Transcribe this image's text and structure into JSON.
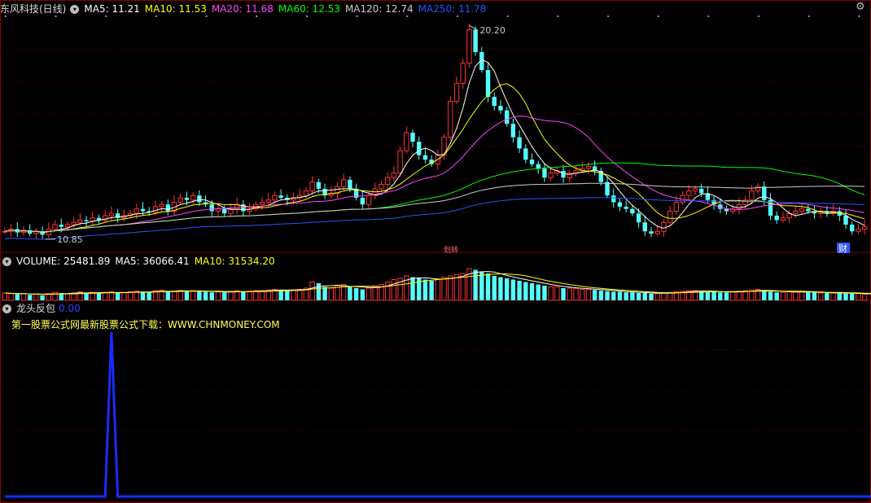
{
  "price_panel": {
    "title": "东风科技(日线)",
    "ma_labels": [
      {
        "text": "MA5: 11.21",
        "color": "#ffffff"
      },
      {
        "text": "MA10: 11.53",
        "color": "#ffff00"
      },
      {
        "text": "MA20: 11.68",
        "color": "#ff44ff"
      },
      {
        "text": "MA60: 12.53",
        "color": "#00ff00"
      },
      {
        "text": "MA120: 12.74",
        "color": "#cccccc"
      },
      {
        "text": "MA250: 11.78",
        "color": "#2255ff"
      }
    ],
    "high_label": "20.20",
    "low_label": "10.85",
    "marker_fin": "财",
    "marker_pink": "划转"
  },
  "volume_panel": {
    "labels": [
      {
        "text": "VOLUME: 25481.89",
        "color": "#ffffff"
      },
      {
        "text": "MA5: 36066.41",
        "color": "#ffffff"
      },
      {
        "text": "MA10: 31534.20",
        "color": "#ffff00"
      }
    ]
  },
  "indicator_panel": {
    "title": "龙头反包",
    "value": "0.00",
    "promo_text": "第一股票公式网最新股票公式下载：WWW.CHNMONEY.COM"
  },
  "colors": {
    "up": "#ff3333",
    "down": "#54ffff",
    "grid": "#7a0000",
    "indicator_line": "#1a2cff"
  },
  "chart_data": {
    "type": "candlestick",
    "close_series": [
      11.0,
      11.1,
      10.95,
      11.05,
      10.9,
      11.0,
      10.85,
      11.1,
      11.3,
      11.2,
      11.3,
      11.4,
      11.5,
      11.45,
      11.6,
      11.5,
      11.7,
      11.8,
      11.6,
      11.7,
      11.8,
      12.0,
      11.9,
      11.85,
      12.1,
      12.2,
      11.9,
      12.3,
      12.5,
      12.4,
      12.6,
      12.3,
      12.2,
      11.9,
      12.0,
      11.8,
      12.0,
      12.2,
      11.9,
      12.0,
      12.2,
      12.3,
      12.4,
      12.6,
      12.5,
      12.4,
      12.5,
      12.6,
      12.8,
      13.2,
      12.9,
      12.6,
      12.7,
      13.0,
      13.3,
      12.9,
      12.5,
      12.2,
      12.6,
      12.9,
      13.1,
      13.4,
      13.6,
      14.6,
      15.4,
      15.0,
      14.4,
      14.2,
      14.0,
      14.4,
      15.2,
      16.8,
      17.6,
      18.5,
      20.0,
      19.0,
      18.2,
      17.0,
      16.6,
      16.4,
      15.8,
      15.2,
      14.7,
      14.2,
      14.0,
      13.8,
      13.4,
      13.6,
      13.7,
      13.4,
      13.6,
      13.7,
      13.8,
      13.9,
      13.7,
      13.2,
      12.6,
      12.3,
      12.1,
      12.0,
      11.8,
      11.4,
      11.0,
      10.9,
      11.0,
      11.4,
      11.9,
      12.3,
      12.6,
      12.8,
      12.9,
      12.7,
      12.4,
      12.2,
      12.0,
      11.9,
      12.0,
      12.2,
      12.4,
      12.8,
      13.0,
      12.4,
      11.7,
      11.5,
      11.6,
      11.8,
      11.9,
      12.0,
      11.9,
      11.8,
      11.9,
      11.8,
      11.9,
      11.7,
      11.3,
      11.0,
      11.1,
      11.2
    ],
    "volume_series": [
      12,
      11,
      10,
      11,
      9,
      10,
      8,
      11,
      13,
      12,
      11,
      12,
      14,
      12,
      13,
      12,
      13,
      14,
      12,
      13,
      14,
      15,
      14,
      13,
      16,
      17,
      14,
      15,
      16,
      15,
      16,
      15,
      14,
      13,
      14,
      13,
      14,
      16,
      14,
      15,
      16,
      16,
      17,
      18,
      17,
      16,
      17,
      18,
      20,
      30,
      28,
      22,
      20,
      24,
      26,
      22,
      20,
      18,
      20,
      24,
      26,
      30,
      34,
      36,
      40,
      38,
      36,
      34,
      32,
      34,
      38,
      40,
      42,
      44,
      52,
      50,
      46,
      44,
      40,
      38,
      36,
      34,
      32,
      30,
      28,
      26,
      24,
      22,
      22,
      20,
      20,
      19,
      18,
      18,
      17,
      16,
      15,
      14,
      14,
      13,
      13,
      12,
      12,
      11,
      11,
      12,
      13,
      14,
      15,
      16,
      16,
      15,
      14,
      14,
      13,
      13,
      14,
      15,
      16,
      17,
      18,
      16,
      14,
      13,
      13,
      14,
      14,
      14,
      13,
      13,
      12,
      12,
      12,
      12,
      11,
      11,
      11,
      10,
      10
    ],
    "indicator_series": [
      0,
      0,
      0,
      0,
      0,
      0,
      0,
      0,
      0,
      0,
      0,
      0,
      0,
      0,
      0,
      0,
      0,
      1,
      0,
      0,
      0,
      0,
      0,
      0,
      0,
      0,
      0,
      0,
      0,
      0,
      0,
      0,
      0,
      0,
      0,
      0,
      0,
      0,
      0,
      0,
      0,
      0,
      0,
      0,
      0,
      0,
      0,
      0,
      0,
      0,
      0,
      0,
      0,
      0,
      0,
      0,
      0,
      0,
      0,
      0,
      0,
      0,
      0,
      0,
      0,
      0,
      0,
      0,
      0,
      0,
      0,
      0,
      0,
      0,
      0,
      0,
      0,
      0,
      0,
      0,
      0,
      0,
      0,
      0,
      0,
      0,
      0,
      0,
      0,
      0,
      0,
      0,
      0,
      0,
      0,
      0,
      0,
      0,
      0,
      0,
      0,
      0,
      0,
      0,
      0,
      0,
      0,
      0,
      0,
      0,
      0,
      0,
      0,
      0,
      0,
      0,
      0,
      0,
      0,
      0,
      0,
      0,
      0,
      0,
      0,
      0,
      0,
      0,
      0,
      0,
      0,
      0,
      0,
      0,
      0,
      0,
      0,
      0,
      0
    ],
    "ylim": [
      10.5,
      20.6
    ]
  }
}
